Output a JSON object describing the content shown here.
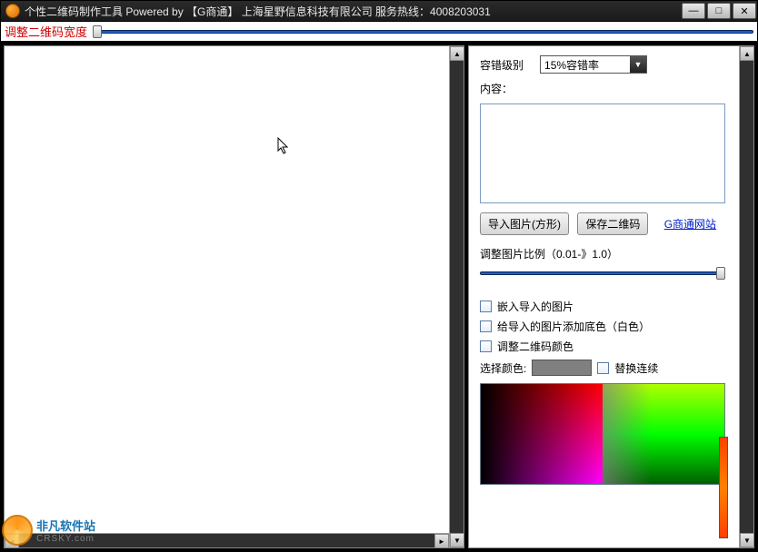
{
  "titlebar": {
    "title": "个性二维码制作工具  Powered by  【G商通】  上海星野信息科技有限公司 服务热线：4008203031"
  },
  "width_adjust": {
    "label": "调整二维码宽度"
  },
  "right": {
    "error_level_label": "容错级别",
    "error_level_value": "15%容错率",
    "content_label": "内容：",
    "import_btn": "导入图片(方形)",
    "save_btn": "保存二维码",
    "website_link": "G商通网站",
    "scale_label": "调整图片比例（0.01-》1.0）",
    "chk_embed": "嵌入导入的图片",
    "chk_bg": "给导入的图片添加底色（白色）",
    "chk_color": "调整二维码颜色",
    "color_label": "选择颜色:",
    "chk_replace": "替换连续"
  },
  "watermark": {
    "site_cn": "非凡软件站",
    "site_en": "CRSKY.com"
  }
}
